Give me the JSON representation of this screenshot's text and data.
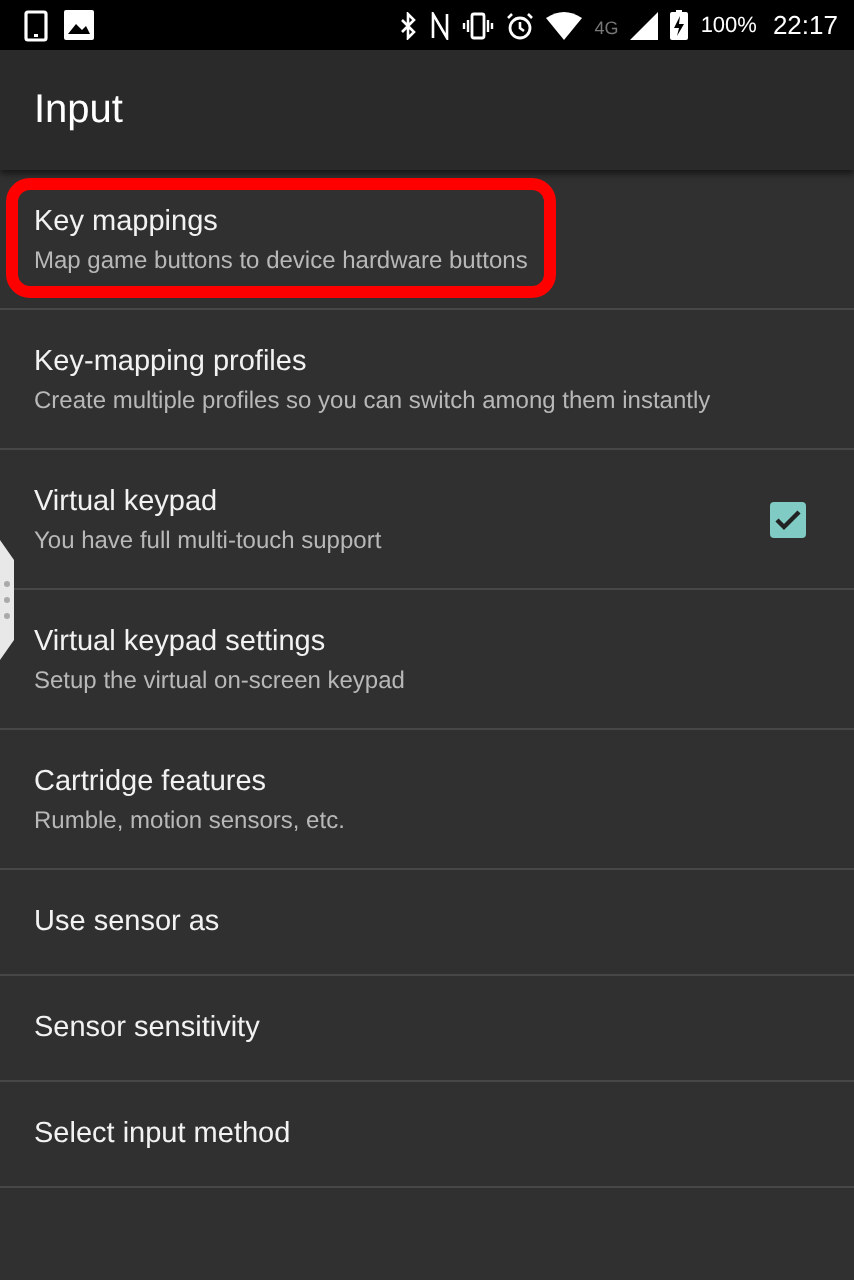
{
  "status_bar": {
    "network": "4G",
    "battery": "100%",
    "time": "22:17"
  },
  "toolbar": {
    "title": "Input"
  },
  "preferences": [
    {
      "title": "Key mappings",
      "summary": "Map game buttons to device hardware buttons",
      "kind": "plain",
      "highlighted": true
    },
    {
      "title": "Key-mapping profiles",
      "summary": "Create multiple profiles so you can switch among them instantly",
      "kind": "plain",
      "highlighted": false
    },
    {
      "title": "Virtual keypad",
      "summary": "You have full multi-touch support",
      "kind": "checkbox",
      "checked": true,
      "highlighted": false
    },
    {
      "title": "Virtual keypad settings",
      "summary": "Setup the virtual on-screen keypad",
      "kind": "plain",
      "highlighted": false
    },
    {
      "title": "Cartridge features",
      "summary": "Rumble, motion sensors, etc.",
      "kind": "plain",
      "highlighted": false
    },
    {
      "title": "Use sensor as",
      "kind": "plain",
      "highlighted": false
    },
    {
      "title": "Sensor sensitivity",
      "kind": "plain",
      "highlighted": false
    },
    {
      "title": "Select input method",
      "kind": "plain",
      "highlighted": false
    }
  ]
}
